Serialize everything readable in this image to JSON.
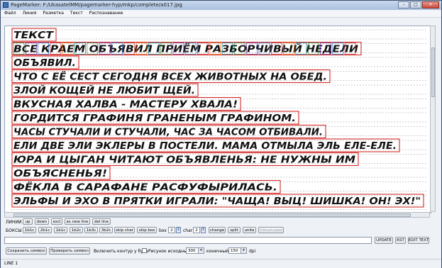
{
  "window": {
    "title": "PageMarker: F:/UkasatelMM/pagemarker-hyp/mkp/complete/a017.jpg"
  },
  "menu": [
    "Файл",
    "Линия",
    "Разметка",
    "Текст",
    "Распознавание"
  ],
  "document": {
    "lines": [
      "ТЕКСТ",
      "ВСЕ КРАЕМ ОБЪЯВИЛ ПРИЁМ РАЗБОРЧИВЫЙ НЕДЕЛИ",
      "ОБЪЯВИЛ.",
      "ЧТО С ЕЁ СЕСТ СЕГОДНЯ ВСЕХ ЖИВОТНЫХ НА ОБЕД.",
      "ЗЛОЙ КОЩЕЙ НЕ ЛЮБИТ ЩЕЙ.",
      "ВКУСНАЯ ХАЛВА - МАСТЕРУ ХВАЛА!",
      "ГОРДИТСЯ ГРАФИНЯ ГРАНЕНЫМ ГРАФИНОМ.",
      "ЧАСЫ СТУЧАЛИ И СТУЧАЛИ, ЧАС ЗА ЧАСОМ ОТБИВАЛИ.",
      "ЕЛИ ДВЕ ЭЛИ ЭКЛЕРЫ В ПОСТЕЛИ. МАМА ОТМЫЛА ЭЛЬ ЕЛЕ-ЕЛЕ.",
      "ЮРА И ЦЫГАН ЧИТАЮТ ОБЪЯВЛЕНЬЯ: НЕ НУЖНЫ ИМ",
      "ОБЪЯСНЕНЬЯ!",
      "ФЁКЛА В САРАФАНЕ РАСФУФЫРИЛАСЬ.",
      "ЭЛЬФЫ И ЭХО В ПРЯТКИ ИГРАЛИ: \"ЧАЩА! ВЫЦ! ШИШКА! ОН! ЭХ!\""
    ]
  },
  "controls": {
    "lines_label": "ЛИНИИ",
    "line_buttons": [
      "up",
      "down",
      "excl",
      "as new line",
      "del line"
    ],
    "boxes_label": "БОКСЫ",
    "box_buttons": [
      "1b1c",
      "2b1c",
      "1b1c",
      "1b2c",
      "1b3c",
      "3b2c",
      "skip char",
      "skip box"
    ],
    "box_label": "box",
    "box_value": "2",
    "char_label": "char",
    "char_value": "2",
    "action_buttons": [
      "change",
      "split",
      "unite",
      "trimunused"
    ],
    "update_button": "UPDATE",
    "rst_button": "RST",
    "edit_text_button": "EDIT TEXT",
    "text_input_value": "",
    "save_symbol_button": "Сохранить символ",
    "check_symbol_button": "Проверить символ",
    "contour_label": "Включить контур у букв",
    "source_picture_label": "Рисунок исходный",
    "source_value": "300",
    "final_label": "конечный",
    "final_value": "150",
    "dpi_label": "dpi"
  },
  "status": {
    "text": "LINE 1"
  },
  "colors": {
    "box_red": "#d32a2a",
    "grid_dash": "#9a9a9a",
    "window_accent": "#3c6fb5"
  }
}
